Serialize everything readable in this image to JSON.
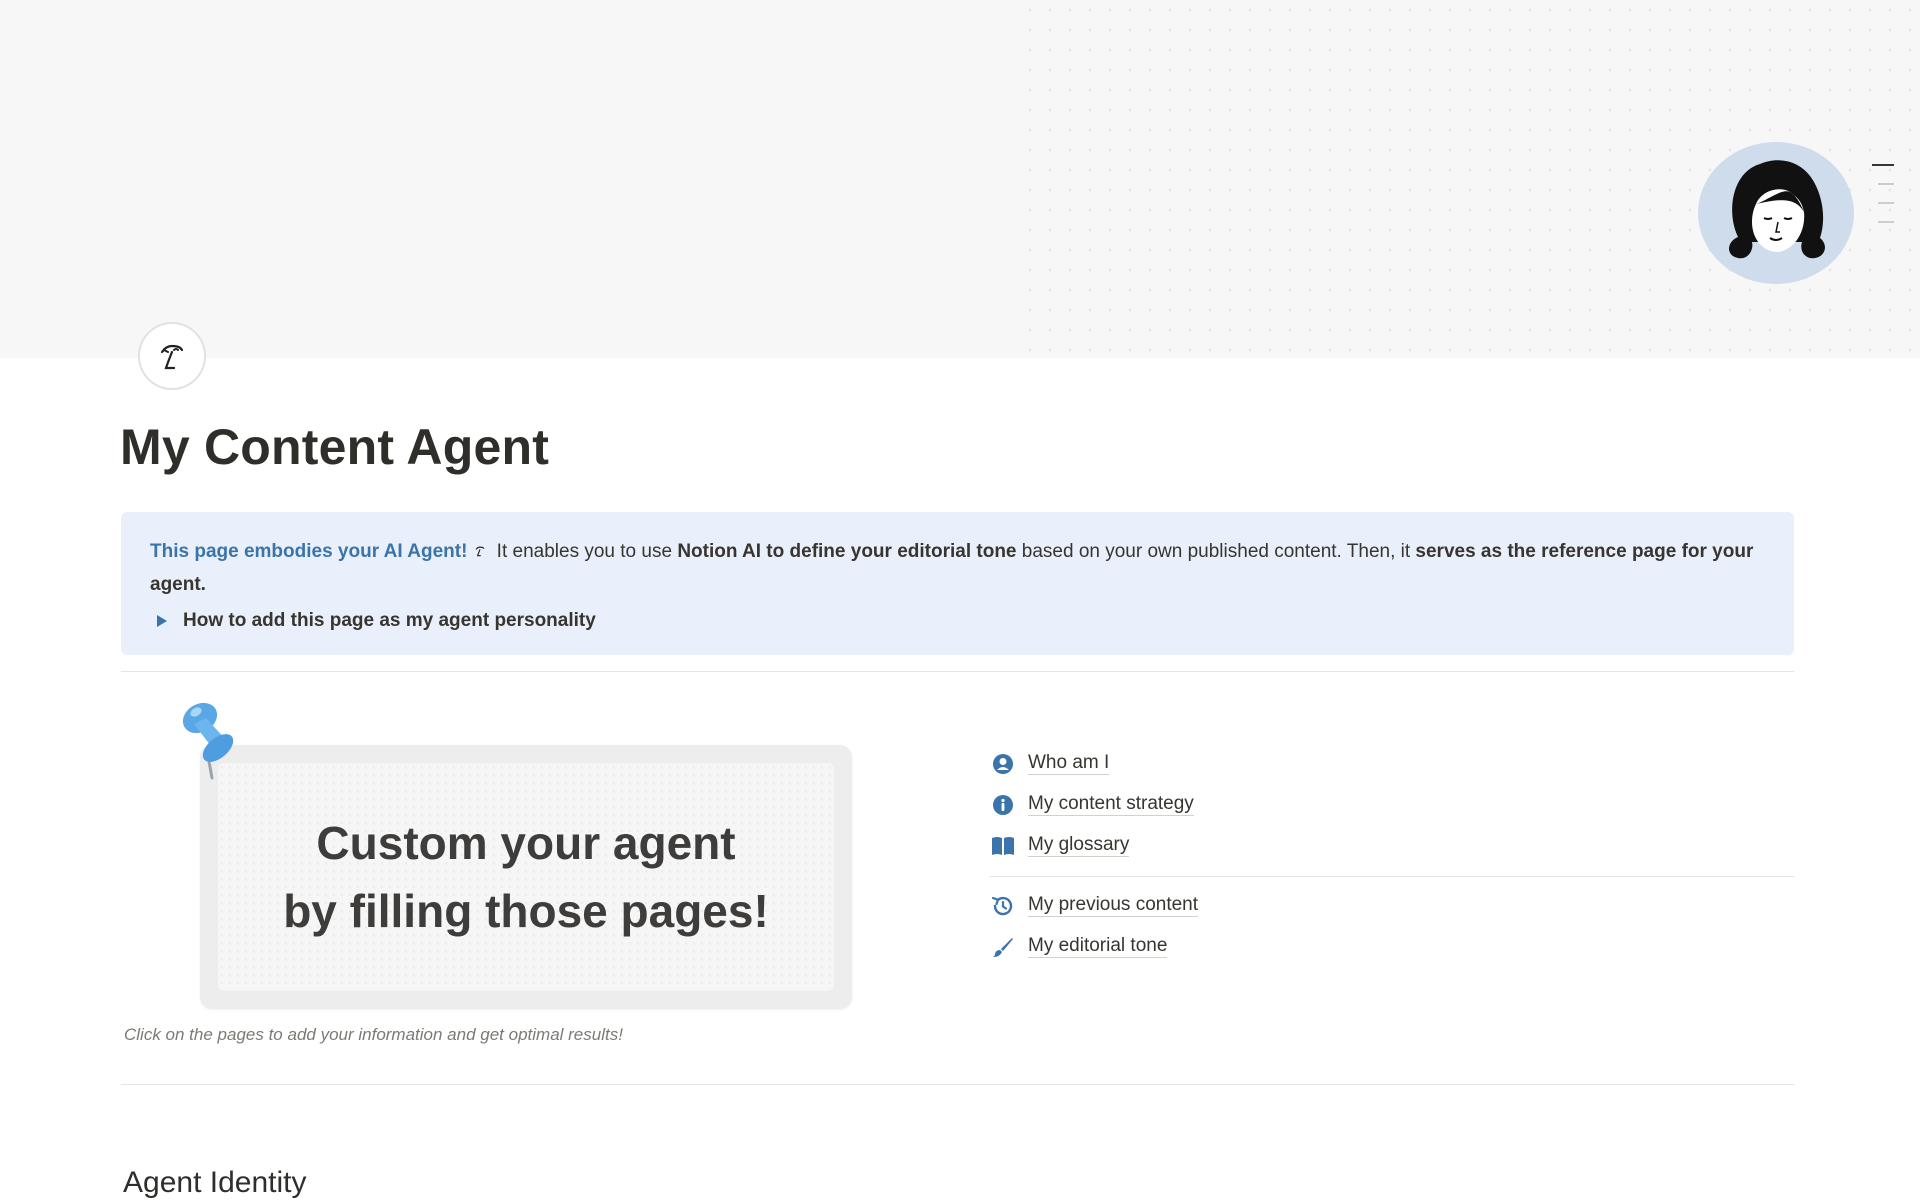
{
  "page": {
    "title": "My Content Agent"
  },
  "callout": {
    "lead": "This page embodies your AI Agent!",
    "text_1": " It enables you to use ",
    "bold_1": "Notion AI to define your editorial tone",
    "text_2": " based on your own published content. Then, it ",
    "bold_2": "serves as the reference page for your agent.",
    "toggle_label": "How to add this page as my agent personality"
  },
  "card": {
    "line_1": "Custom your agent",
    "line_2": "by filling those pages!"
  },
  "caption": "Click on the pages to add your information and get optimal results!",
  "links_group_1": [
    {
      "label": "Who am I",
      "icon": "user-circle-icon"
    },
    {
      "label": "My content strategy",
      "icon": "info-circle-icon"
    },
    {
      "label": "My glossary",
      "icon": "open-book-icon"
    }
  ],
  "links_group_2": [
    {
      "label": "My previous content",
      "icon": "history-icon"
    },
    {
      "label": "My editorial tone",
      "icon": "brush-icon"
    }
  ],
  "section": {
    "heading": "Agent Identity"
  },
  "colors": {
    "accent": "#3a74aa",
    "callout_bg": "#e9f0fb",
    "avatar_bg": "#cfdcec",
    "cover_bg": "#f8f7f7"
  }
}
